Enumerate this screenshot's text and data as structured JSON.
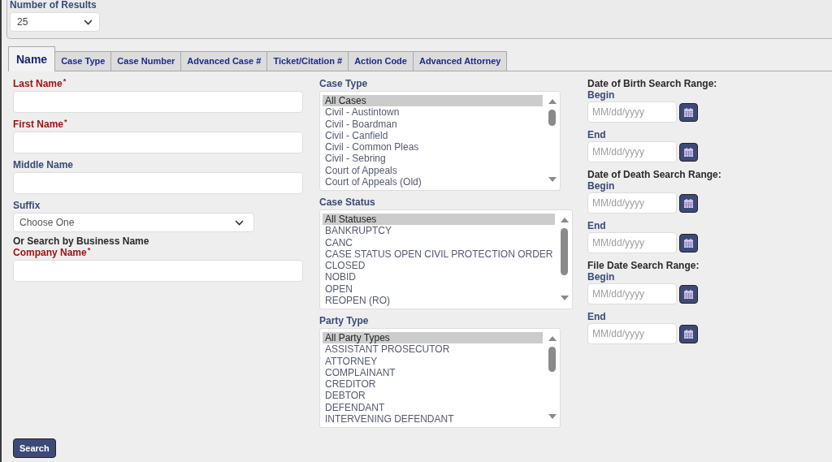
{
  "results": {
    "label": "Number of Results",
    "value": "25"
  },
  "tabs": [
    {
      "label": "Name",
      "selected": true
    },
    {
      "label": "Case Type",
      "selected": false
    },
    {
      "label": "Case Number",
      "selected": false
    },
    {
      "label": "Advanced Case #",
      "selected": false
    },
    {
      "label": "Ticket/Citation #",
      "selected": false
    },
    {
      "label": "Action Code",
      "selected": false
    },
    {
      "label": "Advanced Attorney",
      "selected": false
    }
  ],
  "name_fields": [
    {
      "kind": "text",
      "label": "Last Name$^{*}$",
      "required": true
    },
    {
      "kind": "text",
      "label": "First Name$^{*}$",
      "required": true
    },
    {
      "kind": "text",
      "label": "Middle Name",
      "required": false
    },
    {
      "kind": "select",
      "label": "Suffix",
      "required": false,
      "value": "Choose One"
    },
    {
      "kind": "heading",
      "text": "Or Search by Business Name"
    },
    {
      "kind": "text",
      "label": "Company Name$^{*}$",
      "required": true
    }
  ],
  "lists": [
    {
      "label": "Case Type",
      "options": [
        {
          "text": "All Cases",
          "selected": true
        },
        {
          "text": "Civil - Austintown",
          "selected": false
        },
        {
          "text": "Civil - Boardman",
          "selected": false
        },
        {
          "text": "Civil - Canfield",
          "selected": false
        },
        {
          "text": "Civil - Common Pleas",
          "selected": false
        },
        {
          "text": "Civil - Sebring",
          "selected": false
        },
        {
          "text": "Court of Appeals",
          "selected": false
        },
        {
          "text": "Court of Appeals (Old)",
          "selected": false
        }
      ]
    },
    {
      "label": "Case Status",
      "options": [
        {
          "text": "All Statuses",
          "selected": true
        },
        {
          "text": "BANKRUPTCY",
          "selected": false
        },
        {
          "text": "CANC",
          "selected": false
        },
        {
          "text": "CASE STATUS OPEN CIVIL PROTECTION ORDER",
          "selected": false
        },
        {
          "text": "CLOSED",
          "selected": false
        },
        {
          "text": "NOBID",
          "selected": false
        },
        {
          "text": "OPEN",
          "selected": false
        },
        {
          "text": "REOPEN (RO)",
          "selected": false
        }
      ]
    },
    {
      "label": "Party Type",
      "options": [
        {
          "text": "All Party Types",
          "selected": true
        },
        {
          "text": "ASSISTANT PROSECUTOR",
          "selected": false
        },
        {
          "text": "ATTORNEY",
          "selected": false
        },
        {
          "text": "COMPLAINANT",
          "selected": false
        },
        {
          "text": "CREDITOR",
          "selected": false
        },
        {
          "text": "DEBTOR",
          "selected": false
        },
        {
          "text": "DEFENDANT",
          "selected": false
        },
        {
          "text": "INTERVENING DEFENDANT",
          "selected": false
        }
      ]
    }
  ],
  "date_ranges": [
    {
      "title": "Date of Birth Search Range:",
      "fields": [
        {
          "label": "Begin",
          "placeholder": "MM/dd/yyyy"
        },
        {
          "label": "End",
          "placeholder": "MM/dd/yyyy"
        }
      ]
    },
    {
      "title": "Date of Death Search Range:",
      "fields": [
        {
          "label": "Begin",
          "placeholder": "MM/dd/yyyy"
        },
        {
          "label": "End",
          "placeholder": "MM/dd/yyyy"
        }
      ]
    },
    {
      "title": "File Date Search Range:",
      "fields": [
        {
          "label": "Begin",
          "placeholder": "MM/dd/yyyy"
        },
        {
          "label": "End",
          "placeholder": "MM/dd/yyyy"
        }
      ]
    }
  ],
  "search_button": {
    "label": "Search"
  }
}
